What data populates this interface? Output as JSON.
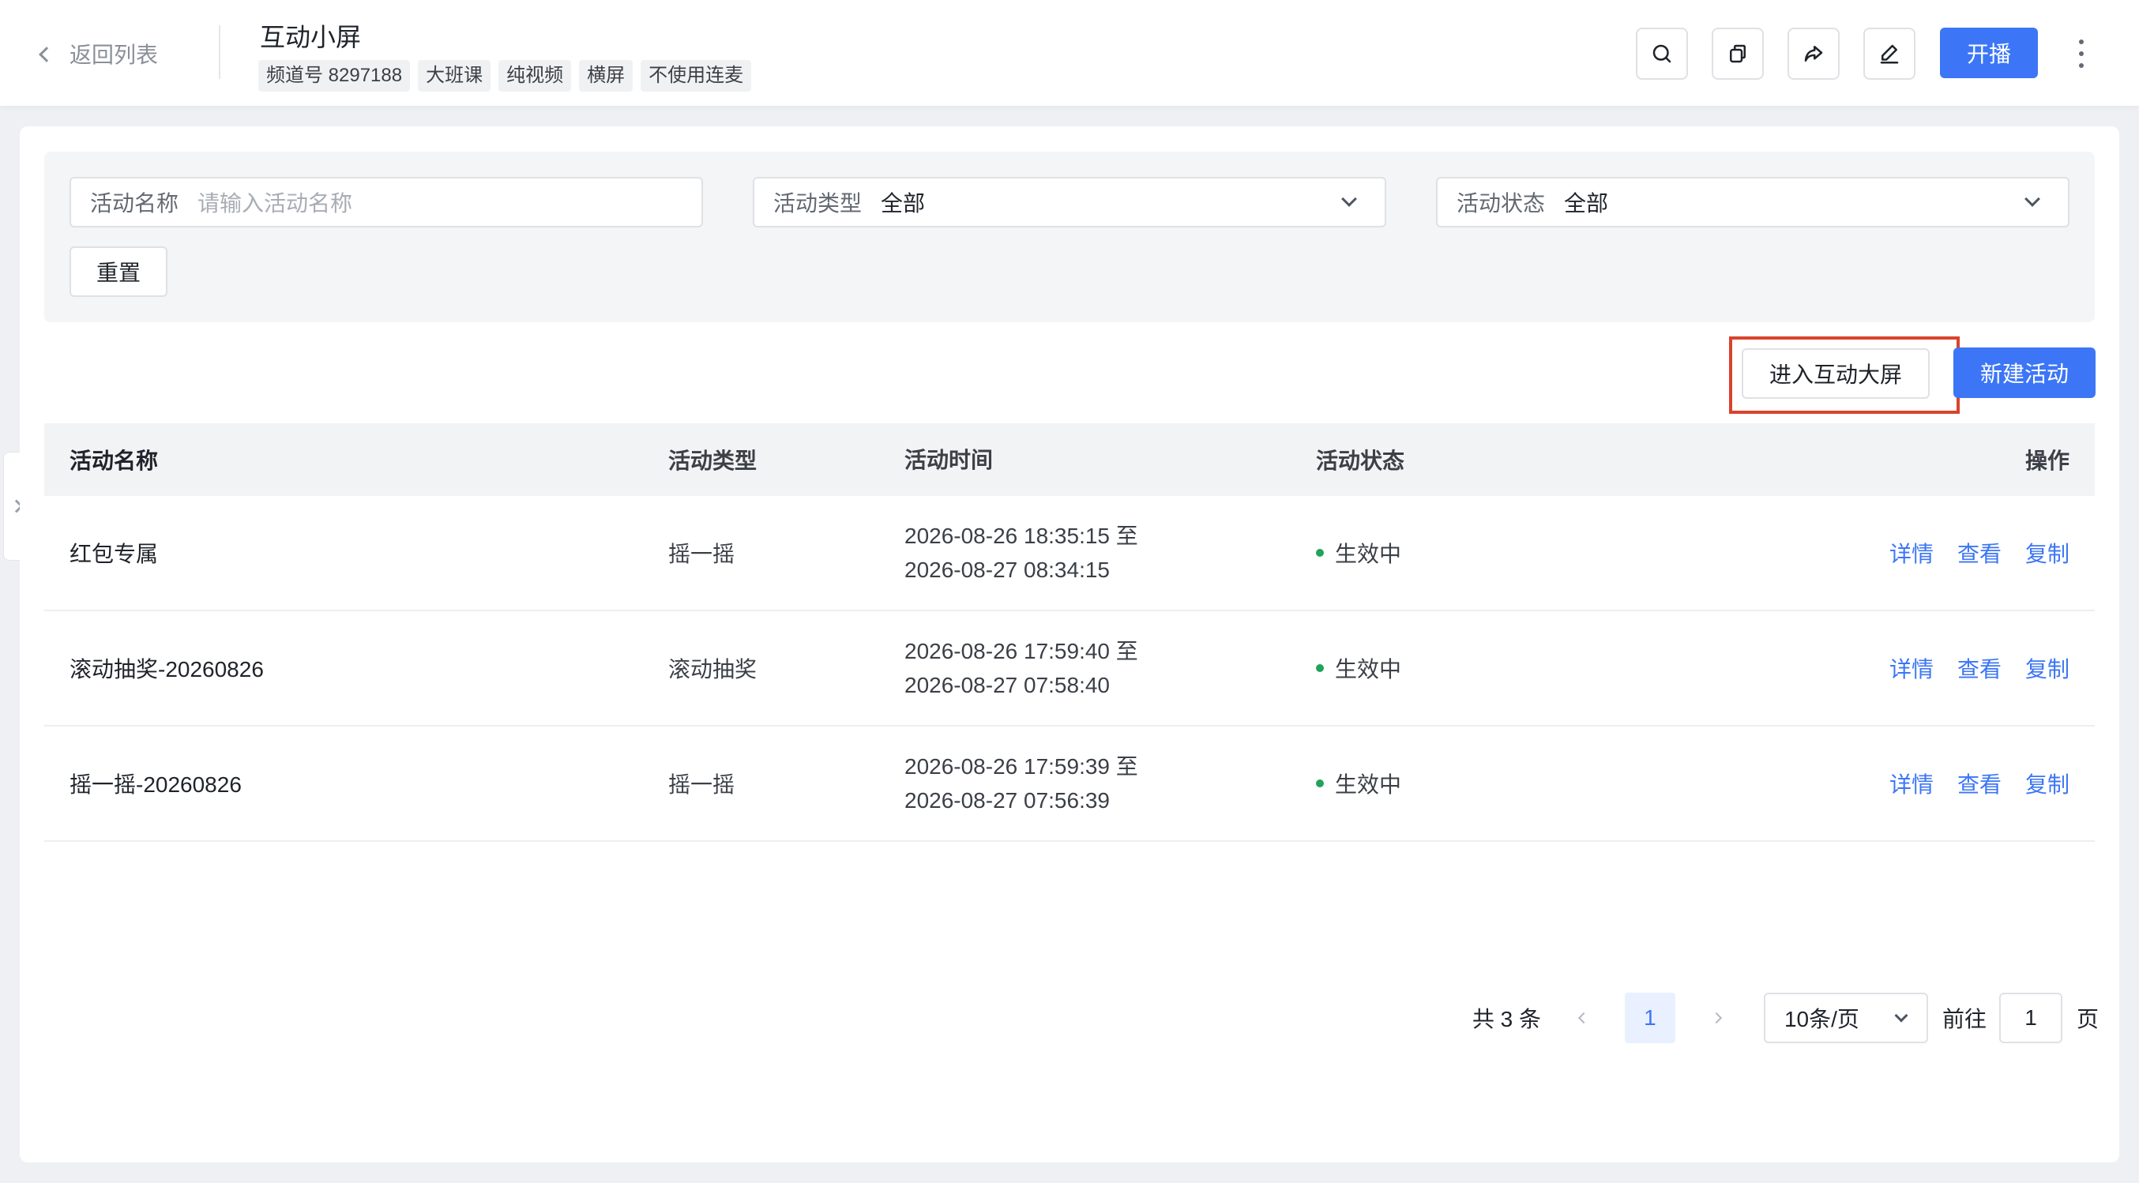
{
  "header": {
    "back_label": "返回列表",
    "title": "互动小屏",
    "tags": [
      "频道号 8297188",
      "大班课",
      "纯视频",
      "横屏",
      "不使用连麦"
    ],
    "live_button": "开播",
    "icons": [
      "search-icon",
      "copy-icon",
      "share-icon",
      "edit-icon",
      "more-vertical-icon"
    ]
  },
  "filters": {
    "name_label": "活动名称",
    "name_placeholder": "请输入活动名称",
    "type_label": "活动类型",
    "type_value": "全部",
    "status_label": "活动状态",
    "status_value": "全部",
    "reset_button": "重置"
  },
  "actions": {
    "enter_big_screen": "进入互动大屏",
    "new_activity": "新建活动"
  },
  "table": {
    "columns": {
      "name": "活动名称",
      "type": "活动类型",
      "time": "活动时间",
      "status": "活动状态",
      "ops": "操作"
    },
    "rows": [
      {
        "name": "红包专属",
        "type": "摇一摇",
        "time_start": "2026-08-26 18:35:15 至",
        "time_end": "2026-08-27 08:34:15",
        "status": "生效中",
        "ops": [
          "详情",
          "查看",
          "复制"
        ]
      },
      {
        "name": "滚动抽奖-20260826",
        "type": "滚动抽奖",
        "time_start": "2026-08-26 17:59:40 至",
        "time_end": "2026-08-27 07:58:40",
        "status": "生效中",
        "ops": [
          "详情",
          "查看",
          "复制"
        ]
      },
      {
        "name": "摇一摇-20260826",
        "type": "摇一摇",
        "time_start": "2026-08-26 17:59:39 至",
        "time_end": "2026-08-27 07:56:39",
        "status": "生效中",
        "ops": [
          "详情",
          "查看",
          "复制"
        ]
      }
    ]
  },
  "pagination": {
    "total": "共 3 条",
    "current_page": "1",
    "page_size": "10条/页",
    "goto_label": "前往",
    "goto_value": "1",
    "page_unit": "页"
  },
  "colors": {
    "primary": "#3c76f6",
    "status_active": "#21a35a",
    "highlight_box": "#d9432d"
  }
}
